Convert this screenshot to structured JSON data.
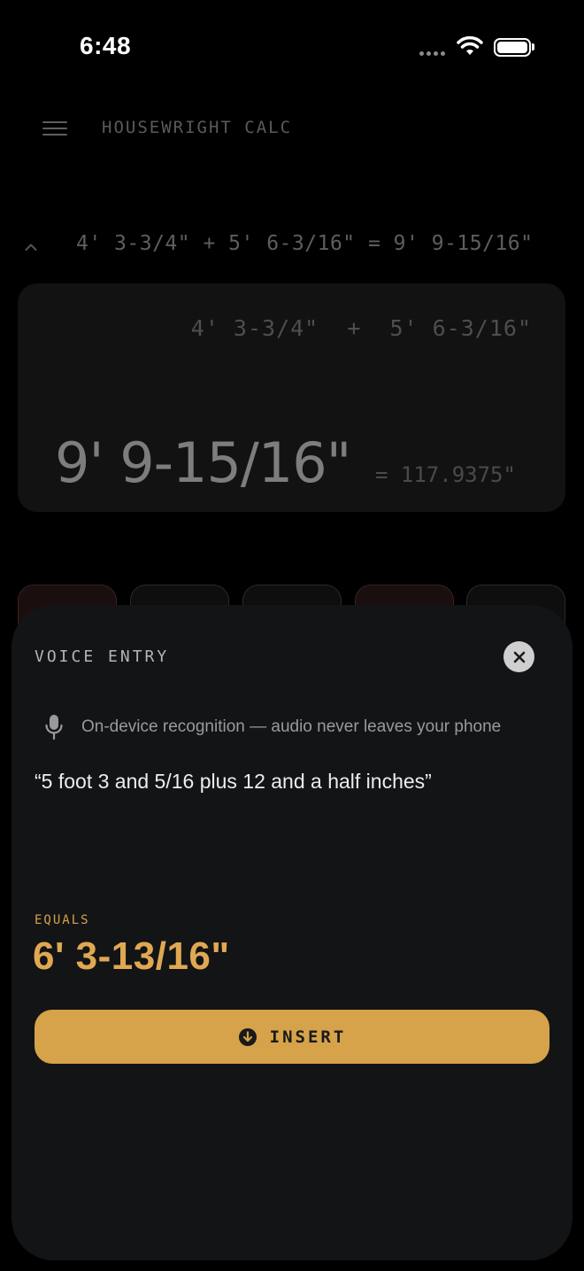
{
  "status_bar": {
    "time": "6:48"
  },
  "header": {
    "title": "HOUSEWRIGHT CALC"
  },
  "history": {
    "line": "4' 3-3/4\" + 5' 6-3/16\" = 9' 9-15/16\""
  },
  "display": {
    "expression": "4' 3-3/4\"  +  5' 6-3/16\"",
    "result": "9' 9-15/16\"",
    "decimal": "= 117.9375\""
  },
  "voice_sheet": {
    "title": "VOICE ENTRY",
    "privacy_note": "On-device recognition — audio never leaves your phone",
    "transcript": "“5 foot 3 and 5/16 plus 12 and a half inches”",
    "equals_label": "EQUALS",
    "equals_value": "6' 3-13/16\"",
    "insert_label": "INSERT"
  },
  "colors": {
    "accent": "#d6a24a",
    "background": "#000000",
    "sheet": "#131416"
  },
  "icons": [
    "menu-icon",
    "chevron-up-icon",
    "close-icon",
    "microphone-icon",
    "arrow-down-circle-icon",
    "wifi-icon",
    "battery-icon",
    "signal-icon"
  ]
}
